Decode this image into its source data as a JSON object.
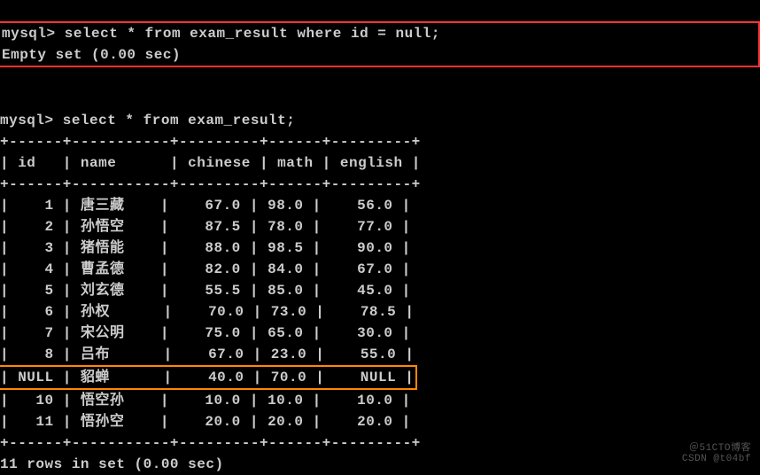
{
  "prompt": "mysql>",
  "query1": "select * from exam_result where id = null;",
  "result1": "Empty set (0.00 sec)",
  "query2": "select * from exam_result;",
  "headers": {
    "id": "id",
    "name": "name",
    "chinese": "chinese",
    "math": "math",
    "english": "english"
  },
  "rows": [
    {
      "id": "1",
      "name": "唐三藏",
      "chinese": "67.0",
      "math": "98.0",
      "english": "56.0"
    },
    {
      "id": "2",
      "name": "孙悟空",
      "chinese": "87.5",
      "math": "78.0",
      "english": "77.0"
    },
    {
      "id": "3",
      "name": "猪悟能",
      "chinese": "88.0",
      "math": "98.5",
      "english": "90.0"
    },
    {
      "id": "4",
      "name": "曹孟德",
      "chinese": "82.0",
      "math": "84.0",
      "english": "67.0"
    },
    {
      "id": "5",
      "name": "刘玄德",
      "chinese": "55.5",
      "math": "85.0",
      "english": "45.0"
    },
    {
      "id": "6",
      "name": "孙权",
      "chinese": "70.0",
      "math": "73.0",
      "english": "78.5"
    },
    {
      "id": "7",
      "name": "宋公明",
      "chinese": "75.0",
      "math": "65.0",
      "english": "30.0"
    },
    {
      "id": "8",
      "name": "吕布",
      "chinese": "67.0",
      "math": "23.0",
      "english": "55.0"
    },
    {
      "id": "NULL",
      "name": "貂蝉",
      "chinese": "40.0",
      "math": "70.0",
      "english": "NULL"
    },
    {
      "id": "10",
      "name": "悟空孙",
      "chinese": "10.0",
      "math": "10.0",
      "english": "10.0"
    },
    {
      "id": "11",
      "name": "悟孙空",
      "chinese": "20.0",
      "math": "20.0",
      "english": "20.0"
    }
  ],
  "footer": "11 rows in set (0.00 sec)",
  "border": "+------+-----------+---------+------+---------+",
  "watermark1": "＠51CTO博客",
  "watermark2": "CSDN @t04bf",
  "chart_data": {
    "type": "table",
    "title": "exam_result",
    "columns": [
      "id",
      "name",
      "chinese",
      "math",
      "english"
    ],
    "data": [
      [
        1,
        "唐三藏",
        67.0,
        98.0,
        56.0
      ],
      [
        2,
        "孙悟空",
        87.5,
        78.0,
        77.0
      ],
      [
        3,
        "猪悟能",
        88.0,
        98.5,
        90.0
      ],
      [
        4,
        "曹孟德",
        82.0,
        84.0,
        67.0
      ],
      [
        5,
        "刘玄德",
        55.5,
        85.0,
        45.0
      ],
      [
        6,
        "孙权",
        70.0,
        73.0,
        78.5
      ],
      [
        7,
        "宋公明",
        75.0,
        65.0,
        30.0
      ],
      [
        8,
        "吕布",
        67.0,
        23.0,
        55.0
      ],
      [
        null,
        "貂蝉",
        40.0,
        70.0,
        null
      ],
      [
        10,
        "悟空孙",
        10.0,
        10.0,
        10.0
      ],
      [
        11,
        "悟孙空",
        20.0,
        20.0,
        20.0
      ]
    ]
  }
}
